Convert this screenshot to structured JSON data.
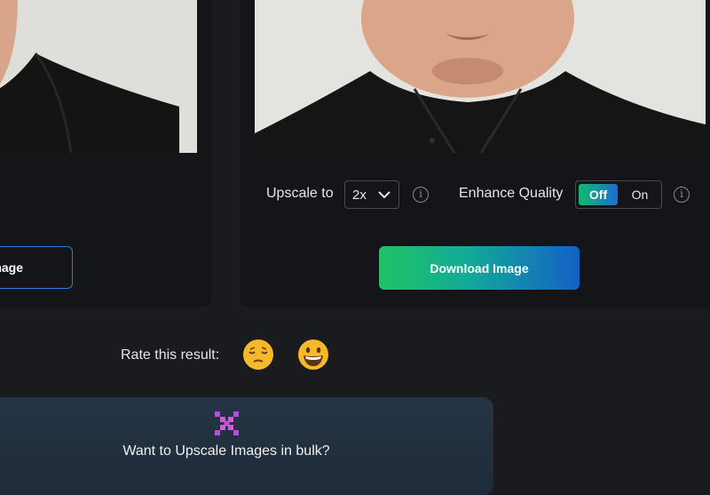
{
  "controls": {
    "upscale_label": "Upscale to",
    "upscale_value": "2x",
    "enhance_label": "Enhance Quality",
    "toggle_off": "Off",
    "toggle_on": "On",
    "info_glyph": "i"
  },
  "buttons": {
    "download": "Download Image",
    "left_partial": "nage"
  },
  "rating": {
    "label": "Rate this result:",
    "icons": [
      "sad-face-icon",
      "happy-face-icon"
    ]
  },
  "bulk": {
    "text": "Want to Upscale Images in bulk?",
    "icon": "grid-pattern-icon"
  },
  "colors": {
    "background": "#1a1b1e",
    "panel": "#141518",
    "accent_green": "#1fc466",
    "accent_blue": "#1560c6",
    "outline_blue": "#2a7de1",
    "bulk_card": "#263445"
  }
}
